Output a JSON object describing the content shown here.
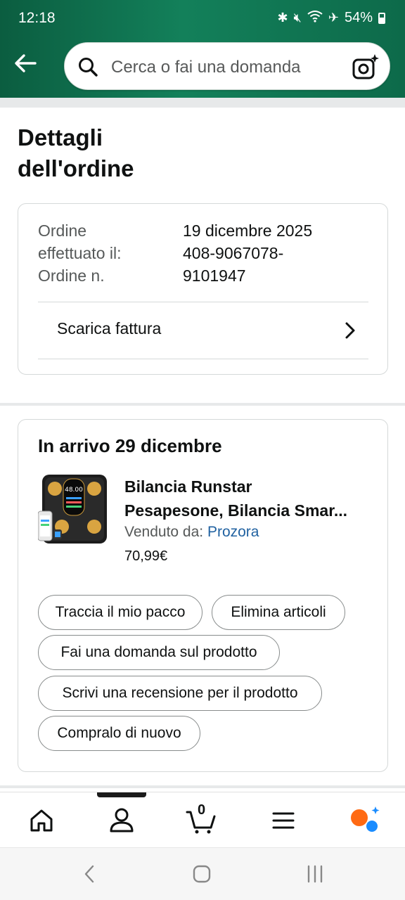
{
  "status_bar": {
    "time": "12:18",
    "battery_pct": "54%",
    "icons": [
      "bluetooth-icon",
      "mute-icon",
      "wifi-icon",
      "airplane-icon",
      "battery-icon"
    ]
  },
  "search": {
    "placeholder": "Cerca o fai una domanda"
  },
  "page": {
    "title_line1": "Dettagli",
    "title_line2": "dell'ordine"
  },
  "order_summary": {
    "placed_label_1": "Ordine",
    "placed_label_2": "effettuato il:",
    "number_label": "Ordine n.",
    "placed_date": "19 dicembre 2025",
    "number_line1": "408-9067078-",
    "number_line2": "9101947",
    "invoice_label": "Scarica fattura"
  },
  "shipment": {
    "arrival": "In arrivo 29 dicembre",
    "product_name_line1": "Bilancia Runstar",
    "product_name_line2": "Pesapesone, Bilancia Smar...",
    "seller_prefix": "Venduto da: ",
    "seller_name": "Prozora",
    "price": "70,99€",
    "actions": {
      "track": "Traccia il mio pacco",
      "delete": "Elimina articoli",
      "ask": "Fai una domanda sul prodotto",
      "review": "Scrivi una recensione per il prodotto",
      "buy_again": "Compralo di nuovo"
    }
  },
  "bottom_nav": {
    "cart_count": "0",
    "items": [
      "home-icon",
      "account-icon",
      "cart-icon",
      "menu-icon",
      "rufus-icon"
    ]
  },
  "colors": {
    "header": "#13805a",
    "link": "#2162a1",
    "rufus_orange": "#ff6a13",
    "rufus_blue": "#1a8cff"
  }
}
